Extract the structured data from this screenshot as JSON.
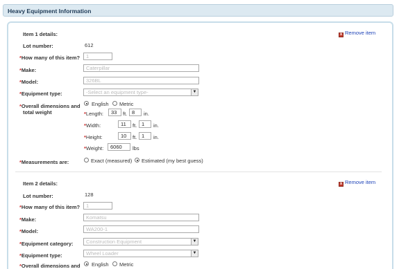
{
  "header": {
    "title": "Heavy Equipment Information"
  },
  "labels": {
    "lot_number": "Lot number:",
    "how_many": "How many of this item?",
    "make": "Make:",
    "model": "Model:",
    "equipment_type": "Equipment type:",
    "equipment_category": "Equipment category:",
    "overall_dimensions_line1": "Overall dimensions and",
    "overall_dimensions_line2": "total weight",
    "measurements_are": "Measurements are:",
    "required_mark": "*",
    "remove_item": "Remove item",
    "length": "Length:",
    "width": "Width:",
    "height": "Height:",
    "weight": "Weight:",
    "ft": "ft.",
    "in": "in.",
    "lbs": "lbs",
    "english": "English",
    "metric": "Metric",
    "exact": "Exact (measured)",
    "estimated": "Estimated (my best guess)",
    "remove_icon_glyph": "x"
  },
  "items": [
    {
      "title": "Item 1 details:",
      "lot_number": "612",
      "quantity": "1",
      "make": "Caterpillar",
      "model": "326BL",
      "equipment_type_placeholder": "-Select an equipment type-",
      "units_selected": "English",
      "length_ft": "33",
      "length_in": "8",
      "width_ft": "11",
      "width_in": "1",
      "height_ft": "10",
      "height_in": "1",
      "weight": "6060",
      "measurements_selected": "Estimated"
    },
    {
      "title": "Item 2 details:",
      "lot_number": "128",
      "quantity": "1",
      "make": "Komatsu",
      "model": "WA200-1",
      "equipment_category": "Construction Equipment",
      "equipment_type": "Wheel Loader",
      "units_selected": "English"
    }
  ],
  "colors": {
    "required": "#d03030",
    "link": "#1f44b8",
    "header_bg": "#dce9f1"
  }
}
